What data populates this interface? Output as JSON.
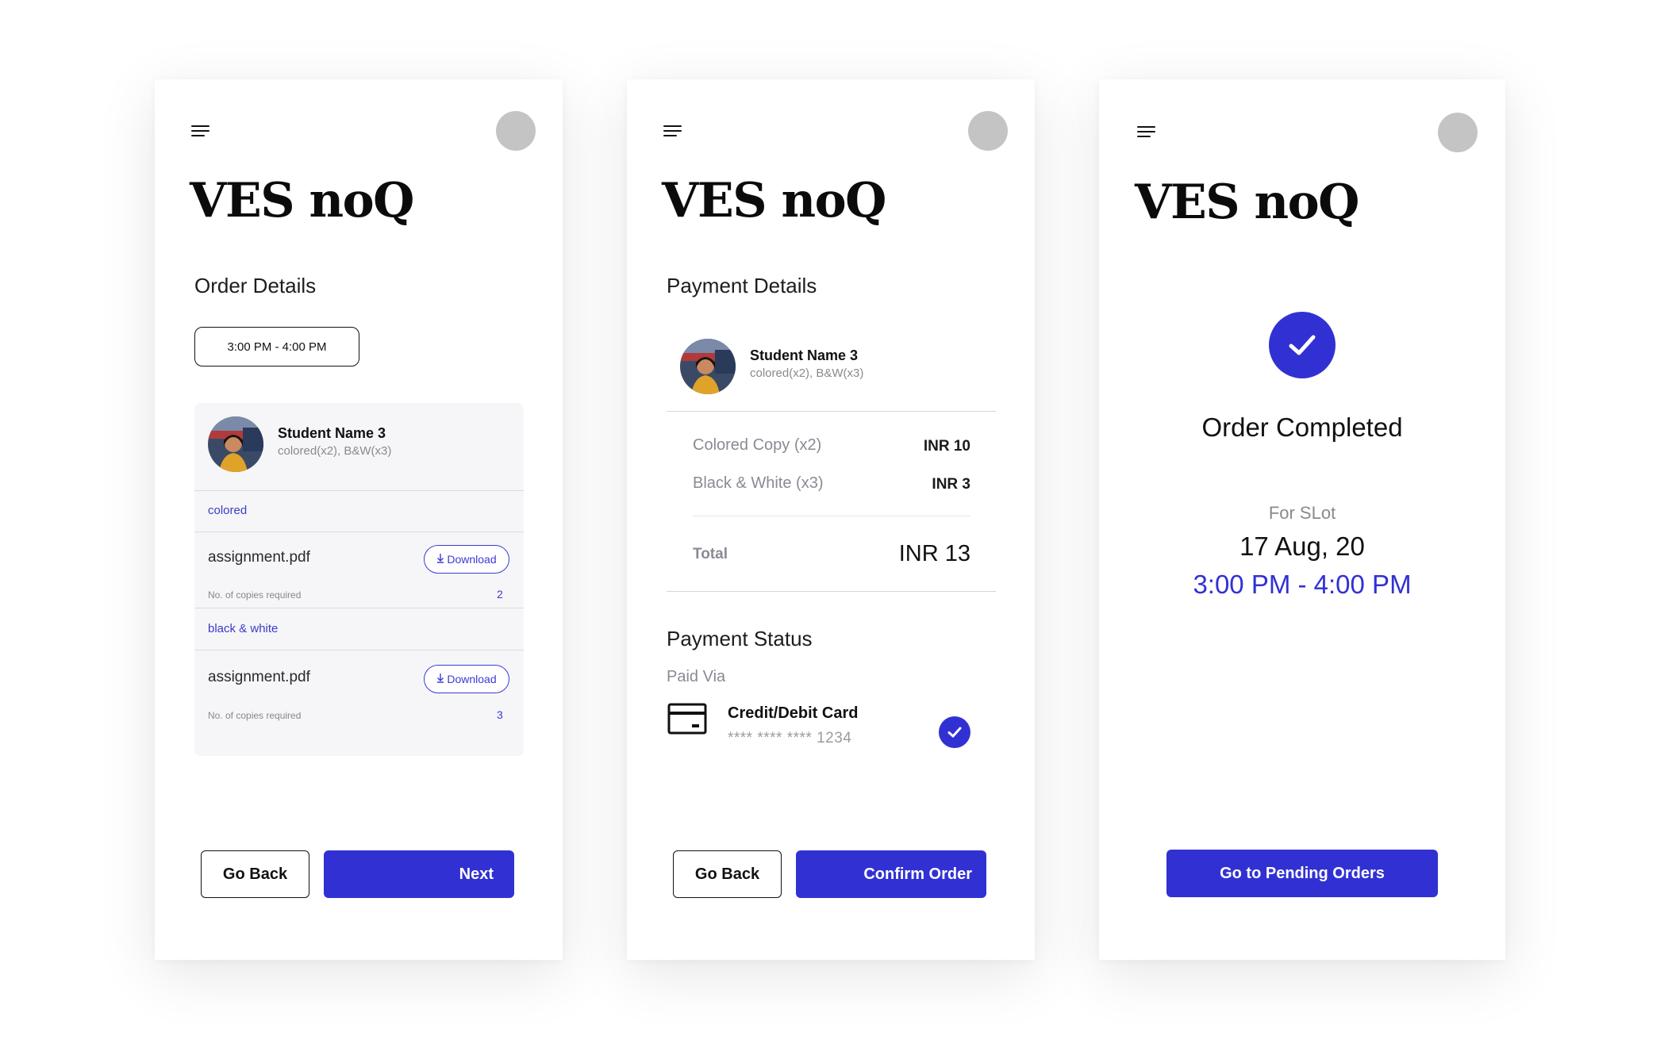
{
  "brand": "VES noQ",
  "colors": {
    "accent": "#3131d3",
    "card_bg": "#f6f6f8"
  },
  "icons": {
    "menu": "hamburger-menu-icon",
    "profile": "profile-avatar",
    "download": "download-arrow-icon",
    "card": "credit-card-icon",
    "check": "checkmark-icon"
  },
  "screen1": {
    "section_title": "Order Details",
    "slot": "3:00 PM - 4:00 PM",
    "student": {
      "name": "Student Name 3",
      "sub": "colored(x2), B&W(x3)"
    },
    "groups": [
      {
        "tag": "colored",
        "file": "assignment.pdf",
        "download_label": "Download",
        "copies_label": "No. of copies required",
        "copies": "2"
      },
      {
        "tag": "black & white",
        "file": "assignment.pdf",
        "download_label": "Download",
        "copies_label": "No. of copies required",
        "copies": "3"
      }
    ],
    "back_label": "Go Back",
    "next_label": "Next"
  },
  "screen2": {
    "section_title": "Payment Details",
    "student": {
      "name": "Student Name 3",
      "sub": "colored(x2), B&W(x3)"
    },
    "lines": [
      {
        "label": "Colored Copy (x2)",
        "amount": "INR 10"
      },
      {
        "label": "Black & White (x3)",
        "amount": "INR 3"
      }
    ],
    "total_label": "Total",
    "total_amount": "INR 13",
    "status_title": "Payment Status",
    "paid_via": "Paid Via",
    "method": "Credit/Debit Card",
    "card_number": "**** **** **** 1234",
    "back_label": "Go Back",
    "confirm_label": "Confirm Order"
  },
  "screen3": {
    "title": "Order Completed",
    "for_slot": "For SLot",
    "date": "17 Aug, 20",
    "time": "3:00 PM - 4:00 PM",
    "button_label": "Go to Pending Orders"
  }
}
